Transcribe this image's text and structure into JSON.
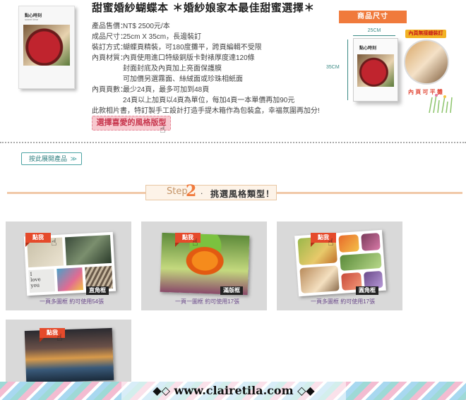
{
  "product": {
    "small_book_title": "點心時刻",
    "small_book_sub": "sweet time",
    "title": "甜蜜婚紗蝴蝶本  ＊婚紗娘家本最佳甜蜜選擇＊",
    "specs": [
      {
        "label": "產品售價：",
        "value": "NT$ 2500元/本"
      },
      {
        "label": "成品尺寸：",
        "value": "25cm X 35cm，長邊裝訂"
      },
      {
        "label": "裝訂方式：",
        "value": "蝴蝶頁精裝，可180度攤平，跨頁編輯不受限"
      },
      {
        "label": "內頁材質：",
        "value": "內頁使用進口特級銅版卡對裱厚度達120條"
      }
    ],
    "spec_indent_lines": [
      "封面封底及內頁加上亮面保護膜",
      "可加價另選霧面、絲絨面或珍珠相紙面"
    ],
    "pages_label": "內頁頁數：",
    "pages_value": "最少24頁，最多可加到48頁",
    "pages_indent": "24頁以上加頁以4頁為單位，每加4頁一本單價再加90元",
    "extra_note": "此款相片書，特訂製手工設計打造手提木箱作為包裝盒，幸福氛圍再加分!",
    "choose_button": "選擇喜愛的風格版型"
  },
  "size_diagram": {
    "ribbon": "商品尺寸",
    "width": "25CM",
    "height": "35CM",
    "big_book_title": "點心時刻",
    "flat_badge": "內頁無接縫裝訂",
    "flat_text": "內 頁 可 平 攤"
  },
  "back_button": "按此展開產品",
  "step": {
    "word": "Step",
    "number": "2",
    "dot": ".",
    "text": "挑選風格類型！"
  },
  "cards": [
    {
      "pick": "點我",
      "label": "直角框",
      "caption": "一頁多圖框 約可使用54張"
    },
    {
      "pick": "點我",
      "label": "滿版框",
      "caption": "一頁一圖框 約可使用17張"
    },
    {
      "pick": "點我",
      "label": "圓角框",
      "caption": "一頁多圖框 約可使用17張"
    },
    {
      "pick": "點我",
      "label": "",
      "caption": ""
    }
  ],
  "footer": {
    "text": "◆◇ www.clairetila.com ◇◆"
  },
  "colors": {
    "accent_orange": "#f07a3c",
    "pink_button": "#f7c9cf",
    "card_bg": "#d9d9d9",
    "caption_purple": "#6b4a8a"
  }
}
